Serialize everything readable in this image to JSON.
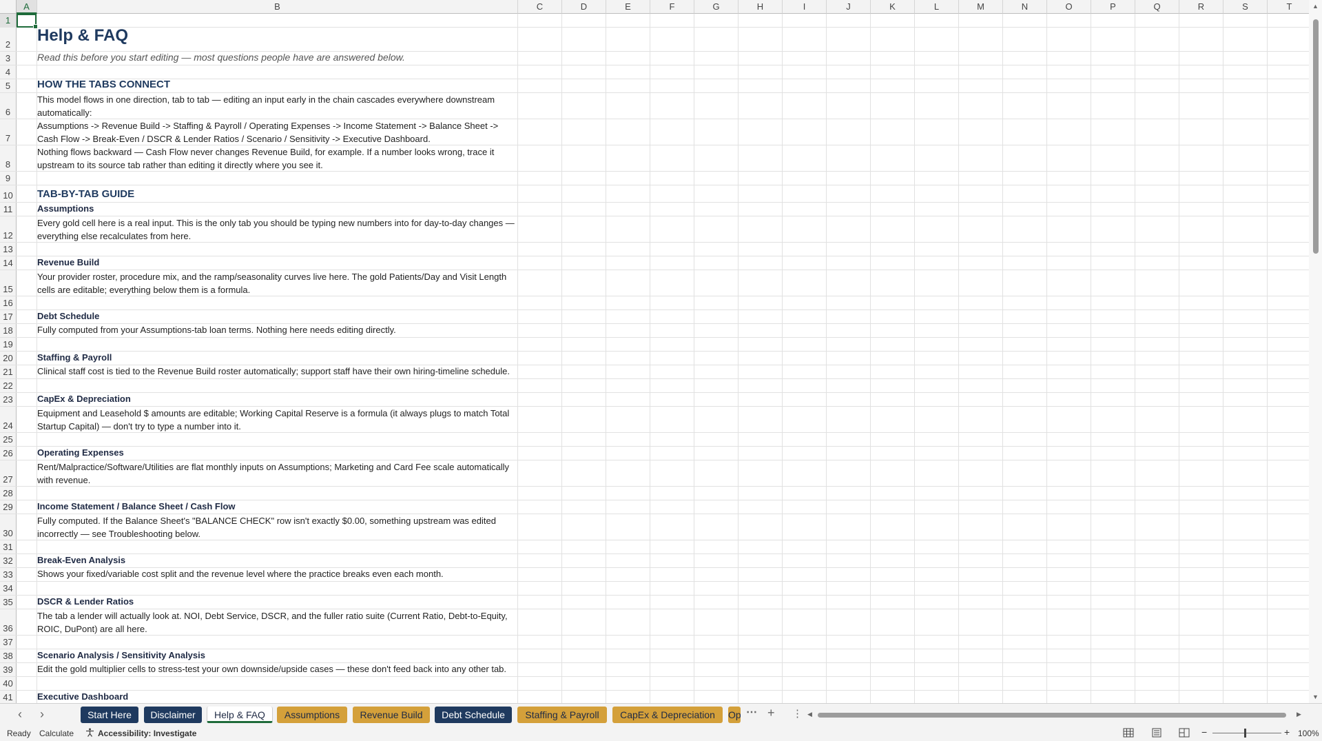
{
  "columns": [
    "A",
    "B",
    "C",
    "D",
    "E",
    "F",
    "G",
    "H",
    "I",
    "J",
    "K",
    "L",
    "M",
    "N",
    "O",
    "P",
    "Q",
    "R",
    "S",
    "T"
  ],
  "rows": [
    {
      "n": "1",
      "h": 20,
      "text": "",
      "style": ""
    },
    {
      "n": "2",
      "h": 35,
      "text": "Help & FAQ",
      "style": "title"
    },
    {
      "n": "3",
      "h": 20,
      "text": "Read this before you start editing — most questions people have are answered below.",
      "style": "sub"
    },
    {
      "n": "4",
      "h": 20,
      "text": "",
      "style": ""
    },
    {
      "n": "5",
      "h": 20,
      "text": "HOW THE TABS CONNECT",
      "style": "section"
    },
    {
      "n": "6",
      "h": 38,
      "text": "This model flows in one direction, tab to tab — editing an input early in the chain cascades everywhere downstream automatically:",
      "style": "body"
    },
    {
      "n": "7",
      "h": 38,
      "text": "Assumptions -> Revenue Build -> Staffing & Payroll / Operating Expenses -> Income Statement -> Balance Sheet -> Cash Flow -> Break-Even / DSCR & Lender Ratios / Scenario / Sensitivity -> Executive Dashboard.",
      "style": "body"
    },
    {
      "n": "8",
      "h": 38,
      "text": "Nothing flows backward — Cash Flow never changes Revenue Build, for example. If a number looks wrong, trace it upstream to its source tab rather than editing it directly where you see it.",
      "style": "body"
    },
    {
      "n": "9",
      "h": 20,
      "text": "",
      "style": ""
    },
    {
      "n": "10",
      "h": 25,
      "text": "TAB-BY-TAB GUIDE",
      "style": "section"
    },
    {
      "n": "11",
      "h": 20,
      "text": "Assumptions",
      "style": "tab"
    },
    {
      "n": "12",
      "h": 38,
      "text": "Every gold cell here is a real input. This is the only tab you should be typing new numbers into for day-to-day changes — everything else recalculates from here.",
      "style": "body"
    },
    {
      "n": "13",
      "h": 20,
      "text": "",
      "style": ""
    },
    {
      "n": "14",
      "h": 20,
      "text": "Revenue Build",
      "style": "tab"
    },
    {
      "n": "15",
      "h": 38,
      "text": "Your provider roster, procedure mix, and the ramp/seasonality curves live here. The gold Patients/Day and Visit Length cells are editable; everything below them is a formula.",
      "style": "body"
    },
    {
      "n": "16",
      "h": 20,
      "text": "",
      "style": ""
    },
    {
      "n": "17",
      "h": 20,
      "text": "Debt Schedule",
      "style": "tab"
    },
    {
      "n": "18",
      "h": 20,
      "text": "Fully computed from your Assumptions-tab loan terms. Nothing here needs editing directly.",
      "style": "body"
    },
    {
      "n": "19",
      "h": 20,
      "text": "",
      "style": ""
    },
    {
      "n": "20",
      "h": 20,
      "text": "Staffing & Payroll",
      "style": "tab"
    },
    {
      "n": "21",
      "h": 20,
      "text": "Clinical staff cost is tied to the Revenue Build roster automatically; support staff have their own hiring-timeline schedule.",
      "style": "body"
    },
    {
      "n": "22",
      "h": 20,
      "text": "",
      "style": ""
    },
    {
      "n": "23",
      "h": 20,
      "text": "CapEx & Depreciation",
      "style": "tab"
    },
    {
      "n": "24",
      "h": 38,
      "text": "Equipment and Leasehold $ amounts are editable; Working Capital Reserve is a formula (it always plugs to match Total Startup Capital) — don't try to type a number into it.",
      "style": "body"
    },
    {
      "n": "25",
      "h": 20,
      "text": "",
      "style": ""
    },
    {
      "n": "26",
      "h": 20,
      "text": "Operating Expenses",
      "style": "tab"
    },
    {
      "n": "27",
      "h": 38,
      "text": "Rent/Malpractice/Software/Utilities are flat monthly inputs on Assumptions; Marketing and Card Fee scale automatically with revenue.",
      "style": "body"
    },
    {
      "n": "28",
      "h": 20,
      "text": "",
      "style": ""
    },
    {
      "n": "29",
      "h": 20,
      "text": "Income Statement / Balance Sheet / Cash Flow",
      "style": "tab"
    },
    {
      "n": "30",
      "h": 38,
      "text": "Fully computed. If the Balance Sheet's \"BALANCE CHECK\" row isn't exactly $0.00, something upstream was edited incorrectly — see Troubleshooting below.",
      "style": "body"
    },
    {
      "n": "31",
      "h": 20,
      "text": "",
      "style": ""
    },
    {
      "n": "32",
      "h": 20,
      "text": "Break-Even Analysis",
      "style": "tab"
    },
    {
      "n": "33",
      "h": 20,
      "text": "Shows your fixed/variable cost split and the revenue level where the practice breaks even each month.",
      "style": "body"
    },
    {
      "n": "34",
      "h": 20,
      "text": "",
      "style": ""
    },
    {
      "n": "35",
      "h": 20,
      "text": "DSCR & Lender Ratios",
      "style": "tab"
    },
    {
      "n": "36",
      "h": 38,
      "text": "The tab a lender will actually look at. NOI, Debt Service, DSCR, and the fuller ratio suite (Current Ratio, Debt-to-Equity, ROIC, DuPont) are all here.",
      "style": "body"
    },
    {
      "n": "37",
      "h": 20,
      "text": "",
      "style": ""
    },
    {
      "n": "38",
      "h": 20,
      "text": "Scenario Analysis / Sensitivity Analysis",
      "style": "tab"
    },
    {
      "n": "39",
      "h": 20,
      "text": "Edit the gold multiplier cells to stress-test your own downside/upside cases — these don't feed back into any other tab.",
      "style": "body"
    },
    {
      "n": "40",
      "h": 20,
      "text": "",
      "style": ""
    },
    {
      "n": "41",
      "h": 20,
      "text": "Executive Dashboard",
      "style": "tab"
    }
  ],
  "sheet_tabs": [
    {
      "label": "Start Here",
      "style": "navy"
    },
    {
      "label": "Disclaimer",
      "style": "navy"
    },
    {
      "label": "Help & FAQ",
      "style": "active"
    },
    {
      "label": "Assumptions",
      "style": "gold"
    },
    {
      "label": "Revenue Build",
      "style": "gold"
    },
    {
      "label": "Debt Schedule",
      "style": "navy"
    },
    {
      "label": "Staffing & Payroll",
      "style": "gold"
    },
    {
      "label": "CapEx & Depreciation",
      "style": "gold"
    },
    {
      "label": "Oper",
      "style": "gold"
    }
  ],
  "status": {
    "ready": "Ready",
    "calculate": "Calculate",
    "accessibility": "Accessibility: Investigate",
    "zoom": "100%"
  },
  "colors": {
    "navy": "#1f3a5f",
    "gold": "#d4a03a",
    "accent": "#1e6b3a"
  }
}
